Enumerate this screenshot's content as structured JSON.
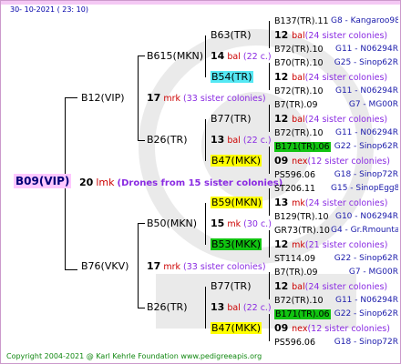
{
  "date": "30- 10-2021 ( 23: 10)",
  "footer": "Copyright 2004-2021 @ Karl Kehrle Foundation     www.pedigreeapis.org",
  "root": {
    "name": "B09(VIP)"
  },
  "gen1": {
    "age": "20",
    "mark": "lmk",
    "note": "(Drones from 15 sister colonies)"
  },
  "upper": {
    "name": "B12(VIP)",
    "age": "17",
    "mark": "mrk",
    "note": "(33 sister colonies)",
    "a": {
      "name": "B615(MKN)",
      "age": "14",
      "mark": "bal",
      "note": "(22 c.)",
      "q1": {
        "name": "B63(TR)"
      },
      "q2": {
        "name": "B54(TR)"
      }
    },
    "b": {
      "name": "B26(TR)",
      "age": "13",
      "mark": "bal",
      "note": "(22 c.)",
      "q1": {
        "name": "B77(TR)"
      },
      "q2": {
        "name": "B47(MKK)"
      }
    }
  },
  "lower": {
    "name": "B76(VKV)",
    "age": "17",
    "mark": "mrk",
    "note": "(33 sister colonies)",
    "a": {
      "name": "B50(MKN)",
      "age": "15",
      "mark": "mk",
      "note": "(30 c.)",
      "q1": {
        "name": "B59(MKN)"
      },
      "q2": {
        "name": "B53(MKK)"
      }
    },
    "b": {
      "name": "B26(TR)",
      "age": "13",
      "mark": "bal",
      "note": "(22 c.)",
      "q1": {
        "name": "B77(TR)"
      },
      "q2": {
        "name": "B47(MKK)"
      }
    }
  },
  "rows": [
    {
      "a": "B137(TR).11",
      "b": "G8 - Kangaroo98R"
    },
    {
      "age": "12",
      "mark": "bal",
      "note": "(24 sister colonies)"
    },
    {
      "a": "B72(TR).10",
      "b": "G11 - N06294R"
    },
    {
      "a": "B70(TR).10",
      "b": "G25 - Sinop62R"
    },
    {
      "age": "12",
      "mark": "bal",
      "note": "(24 sister colonies)"
    },
    {
      "a": "B72(TR).10",
      "b": "G11 - N06294R"
    },
    {
      "a": "B7(TR).09",
      "b": "G7 - MG00R"
    },
    {
      "age": "12",
      "mark": "bal",
      "note": "(24 sister colonies)"
    },
    {
      "a": "B72(TR).10",
      "b": "G11 - N06294R"
    },
    {
      "a": "B171(TR).06",
      "b": "G22 - Sinop62R"
    },
    {
      "age": "09",
      "mark": "nex",
      "note": "(12 sister colonies)"
    },
    {
      "a": "PS596.06",
      "b": "G18 - Sinop72R"
    },
    {
      "a": "ST206.11",
      "b": "G15 - SinopEgg86R"
    },
    {
      "age": "13",
      "mark": "mk",
      "note": "(24 sister colonies)"
    },
    {
      "a": "B129(TR).10",
      "b": "G10 - N06294R"
    },
    {
      "a": "GR73(TR).10",
      "b": "G4 - Gr.Rmounta"
    },
    {
      "age": "12",
      "mark": "mk",
      "note": "(21 sister colonies)"
    },
    {
      "a": "ST114.09",
      "b": "G22 - Sinop62R"
    },
    {
      "a": "B7(TR).09",
      "b": "G7 - MG00R"
    },
    {
      "age": "12",
      "mark": "bal",
      "note": "(24 sister colonies)"
    },
    {
      "a": "B72(TR).10",
      "b": "G11 - N06294R"
    },
    {
      "a": "B171(TR).06",
      "b": "G22 - Sinop62R"
    },
    {
      "age": "09",
      "mark": "nex",
      "note": "(12 sister colonies)"
    },
    {
      "a": "PS596.06",
      "b": "G18 - Sinop72R"
    }
  ]
}
